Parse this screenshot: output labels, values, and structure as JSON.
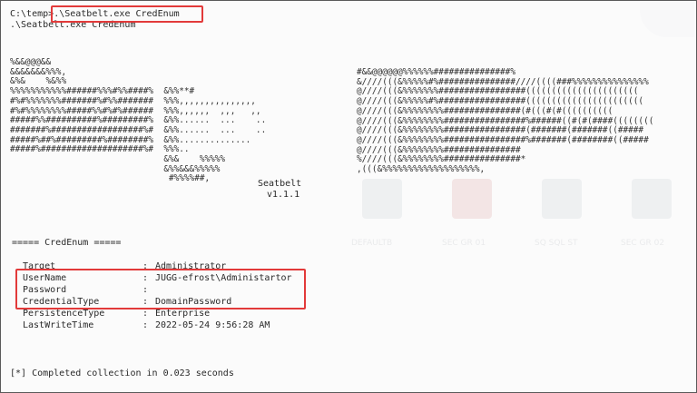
{
  "command": {
    "prompt": "C:\\temp",
    "prompt_sep": ">",
    "typed": ".\\Seatbelt.exe CredEnum",
    "echo": ".\\Seatbelt.exe CredEnum"
  },
  "banner": {
    "left_art": "%&&@@@&&\n&&&&&&&%%%,\n&%&    %&%%\n%%%%%%%%%%%######%%%#%%####%  &%%**#\n#%#%%%%%%%#######%#%%#######  %%%,,,,,,,,,,,,,,,\n#%#%%%%%%%%#####%%#%#%######  %%%,,,,,,  ,,,   ,,\n#####%%##########%#########%  &%%......  ...    ..\n#######%##################%#  &%%......  ...    ..\n#####%##%#########%########%  &%%..............\n#####%####################%#  %%%..\n                              &%&    %%%%%\n                              &%%&&&%%%%%\n                               #%%%%##,",
    "right_art": "#&&@@@@@@%%%%%%###############%\n&////(((&%%%%%#%###############////((((###%%%%%%%%%%%%%%%\n@////(((&%%%%%%%#################((((((((((((((((((((((\n@////(((&%%%%%#%#################(((((((((((((((((((((((\n@////(((&%%%%%%%%###############(#(((#(#((((((((((\n@////(((&%%%%%%%%################%######((#(#(####((((((((\n@////(((&%%%%%%%%################(#######(#######((#####\n@////(((&%%%%%%%%################%#######(########((#####\n@////(((&%%%%%%%%###############\n%////(((&%%%%%%%%###############*\n,(((&%%%%%%%%%%%%%%%%%%%,",
    "tool_name": "Seatbelt",
    "version": "v1.1.1"
  },
  "section": {
    "rule_left": "=====",
    "title": "CredEnum",
    "rule_right": "====="
  },
  "results": [
    {
      "key": "Target",
      "sep": ":",
      "value": "Administrator"
    },
    {
      "key": "UserName",
      "sep": ":",
      "value": "JUGG-efrost\\Administartor"
    },
    {
      "key": "Password",
      "sep": ":",
      "value": ""
    },
    {
      "key": "CredentialType",
      "sep": ":",
      "value": "DomainPassword"
    },
    {
      "key": "PersistenceType",
      "sep": ":",
      "value": "Enterprise"
    },
    {
      "key": "LastWriteTime",
      "sep": ":",
      "value": "2022-05-24 9:56:28 AM"
    }
  ],
  "footer": "[*] Completed collection in 0.023 seconds",
  "background_window": {
    "labels": [
      "DEFAULTB",
      "SEC GR 01",
      "SQ SQL ST",
      "SEC GR 02"
    ]
  },
  "colors": {
    "highlight": "#e23a3a",
    "text": "#2a2a2a",
    "background": "#fbfbfb"
  }
}
